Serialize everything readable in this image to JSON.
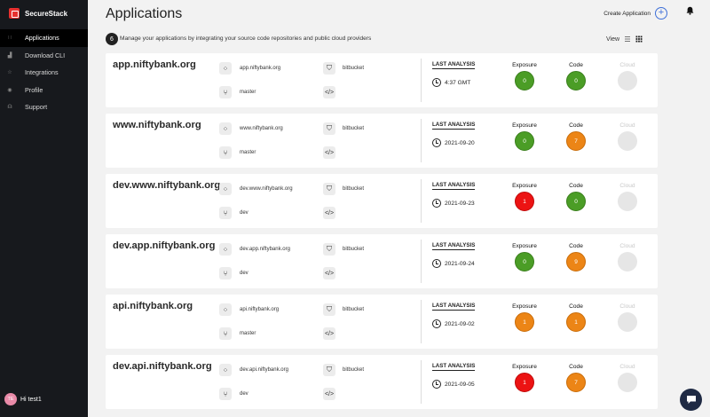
{
  "brand": {
    "name": "SecureStack"
  },
  "nav": [
    {
      "label": "Applications",
      "icon": "grid-dots-icon",
      "active": true
    },
    {
      "label": "Download CLI",
      "icon": "bar-chart-icon",
      "active": false
    },
    {
      "label": "Integrations",
      "icon": "star-icon",
      "active": false
    },
    {
      "label": "Profile",
      "icon": "eye-icon",
      "active": false
    },
    {
      "label": "Support",
      "icon": "headset-icon",
      "active": false
    }
  ],
  "user": {
    "initials": "TE",
    "greeting": "Hi test1"
  },
  "header": {
    "title": "Applications",
    "create_label": "Create Application",
    "count": "6",
    "subtitle": "Manage your applications by integrating your source code repositories and public cloud providers",
    "view_label": "View"
  },
  "labels": {
    "last_analysis": "LAST ANALYSIS",
    "exposure": "Exposure",
    "code": "Code",
    "cloud": "Cloud"
  },
  "apps": [
    {
      "name": "app.niftybank.org",
      "domain": "app.niftybank.org",
      "repo_provider": "bitbucket",
      "branch": "master",
      "last_analysis": "4:37 GMT",
      "exposure": "0",
      "exposure_status": "green",
      "code": "0",
      "code_status": "green"
    },
    {
      "name": "www.niftybank.org",
      "domain": "www.niftybank.org",
      "repo_provider": "bitbucket",
      "branch": "master",
      "last_analysis": "2021-09-20",
      "exposure": "0",
      "exposure_status": "green",
      "code": "7",
      "code_status": "orange"
    },
    {
      "name": "dev.www.niftybank.org",
      "domain": "dev.www.niftybank.org",
      "repo_provider": "bitbucket",
      "branch": "dev",
      "last_analysis": "2021-09-23",
      "exposure": "1",
      "exposure_status": "red",
      "code": "0",
      "code_status": "green"
    },
    {
      "name": "dev.app.niftybank.org",
      "domain": "dev.app.niftybank.org",
      "repo_provider": "bitbucket",
      "branch": "dev",
      "last_analysis": "2021-09-24",
      "exposure": "0",
      "exposure_status": "green",
      "code": "9",
      "code_status": "orange"
    },
    {
      "name": "api.niftybank.org",
      "domain": "api.niftybank.org",
      "repo_provider": "bitbucket",
      "branch": "master",
      "last_analysis": "2021-09-02",
      "exposure": "1",
      "exposure_status": "orange",
      "code": "1",
      "code_status": "orange"
    },
    {
      "name": "dev.api.niftybank.org",
      "domain": "dev.api.niftybank.org",
      "repo_provider": "bitbucket",
      "branch": "dev",
      "last_analysis": "2021-09-05",
      "exposure": "1",
      "exposure_status": "red",
      "code": "7",
      "code_status": "orange"
    }
  ]
}
